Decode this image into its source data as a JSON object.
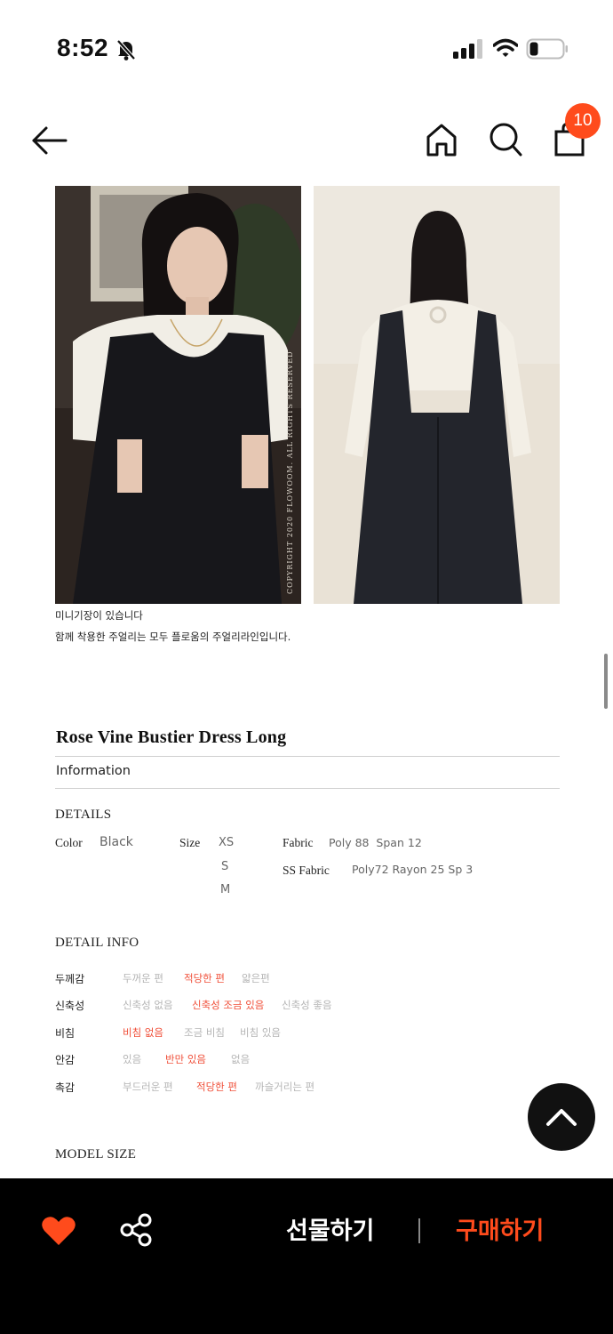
{
  "status_bar": {
    "time": "8:52"
  },
  "nav": {
    "cart_count": "10"
  },
  "photos": {
    "copyright": "COPYRIGHT 2020 FLOWOOM. ALL RIGHTS RESERVED"
  },
  "captions": [
    "미니기장이 있습니다",
    "함께 착용한 주얼리는 모두 플로움의 주얼리라인입니다."
  ],
  "product": {
    "title": "Rose Vine Bustier Dress Long",
    "info_tab": "Information"
  },
  "details": {
    "heading": "DETAILS",
    "color_label": "Color",
    "color_value": "Black",
    "size_label": "Size",
    "sizes": [
      "XS",
      "S",
      "M"
    ],
    "fabric_label": "Fabric",
    "fabric_value": "Poly 88  Span 12",
    "ss_fabric_label": "SS Fabric",
    "ss_fabric_value": "Poly72 Rayon 25 Sp 3"
  },
  "detail_info": {
    "heading": "DETAIL INFO",
    "rows": [
      {
        "label": "두께감",
        "options": [
          "두꺼운 편",
          "적당한 편",
          "얇은편"
        ],
        "selected": 1
      },
      {
        "label": "신축성",
        "options": [
          "신축성 없음",
          "신축성 조금 있음",
          "신축성 좋음"
        ],
        "selected": 1
      },
      {
        "label": "비침",
        "options": [
          "비침 없음",
          "조금 비침",
          "비침 있음"
        ],
        "selected": 0
      },
      {
        "label": "안감",
        "options": [
          "있음",
          "반만 있음",
          "없음"
        ],
        "selected": 1
      },
      {
        "label": "촉감",
        "options": [
          "부드러운 편",
          "적당한 편",
          "까슬거리는 편"
        ],
        "selected": 1
      }
    ]
  },
  "model_size": {
    "heading": "MODEL SIZE"
  },
  "bottom_bar": {
    "gift_label": "선물하기",
    "buy_label": "구매하기"
  },
  "colors": {
    "accent": "#ff4b1c",
    "selected_option": "#f0503a",
    "muted_option": "#b5b5b5",
    "bar_bg": "#000000"
  },
  "icons": [
    "bell-slash-icon",
    "signal-icon",
    "wifi-icon",
    "battery-icon",
    "back-arrow-icon",
    "home-icon",
    "search-icon",
    "shopping-bag-icon",
    "chevron-up-icon",
    "heart-icon",
    "share-icon"
  ]
}
